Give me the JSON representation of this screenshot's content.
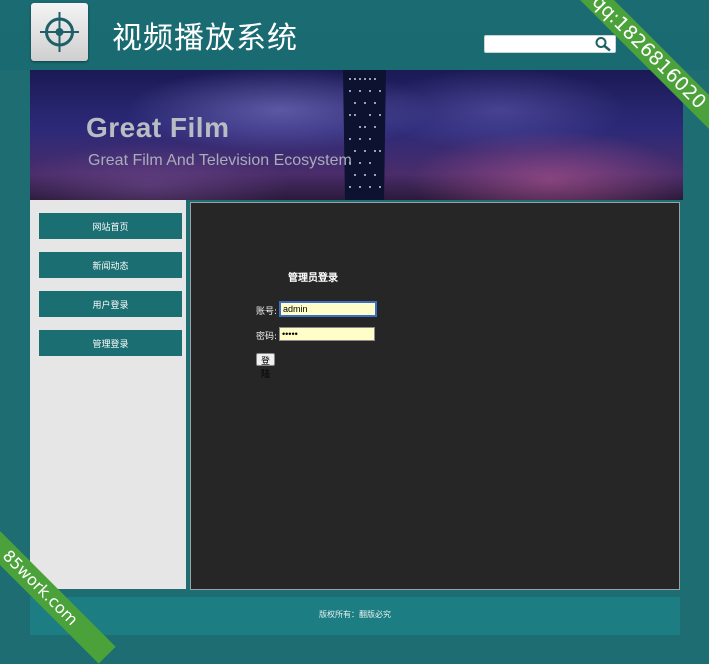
{
  "header": {
    "site_title": "视频播放系统",
    "search_placeholder": "",
    "icons": [
      "crosshair-logo-icon",
      "search-icon"
    ]
  },
  "banner": {
    "title": "Great Film",
    "subtitle": "Great Film And Television Ecosystem"
  },
  "sidebar": {
    "items": [
      {
        "label": "网站首页"
      },
      {
        "label": "新闻动态"
      },
      {
        "label": "用户登录"
      },
      {
        "label": "管理登录"
      }
    ]
  },
  "login": {
    "title": "管理员登录",
    "username_label": "账号:",
    "username_value": "admin",
    "password_label": "密码:",
    "password_value": "•••••",
    "button_label": "登陆"
  },
  "footer": {
    "copyright": "版权所有：翻版必究"
  },
  "watermarks": {
    "top_right": "qq:1826816020",
    "bottom_left": "85work.com"
  },
  "colors": {
    "header_bg": "#1a6b72",
    "nav_bg": "#1b6e72",
    "main_bg": "#262626",
    "ribbon": "#4ca23a",
    "field_bg": "#fffdc8"
  }
}
